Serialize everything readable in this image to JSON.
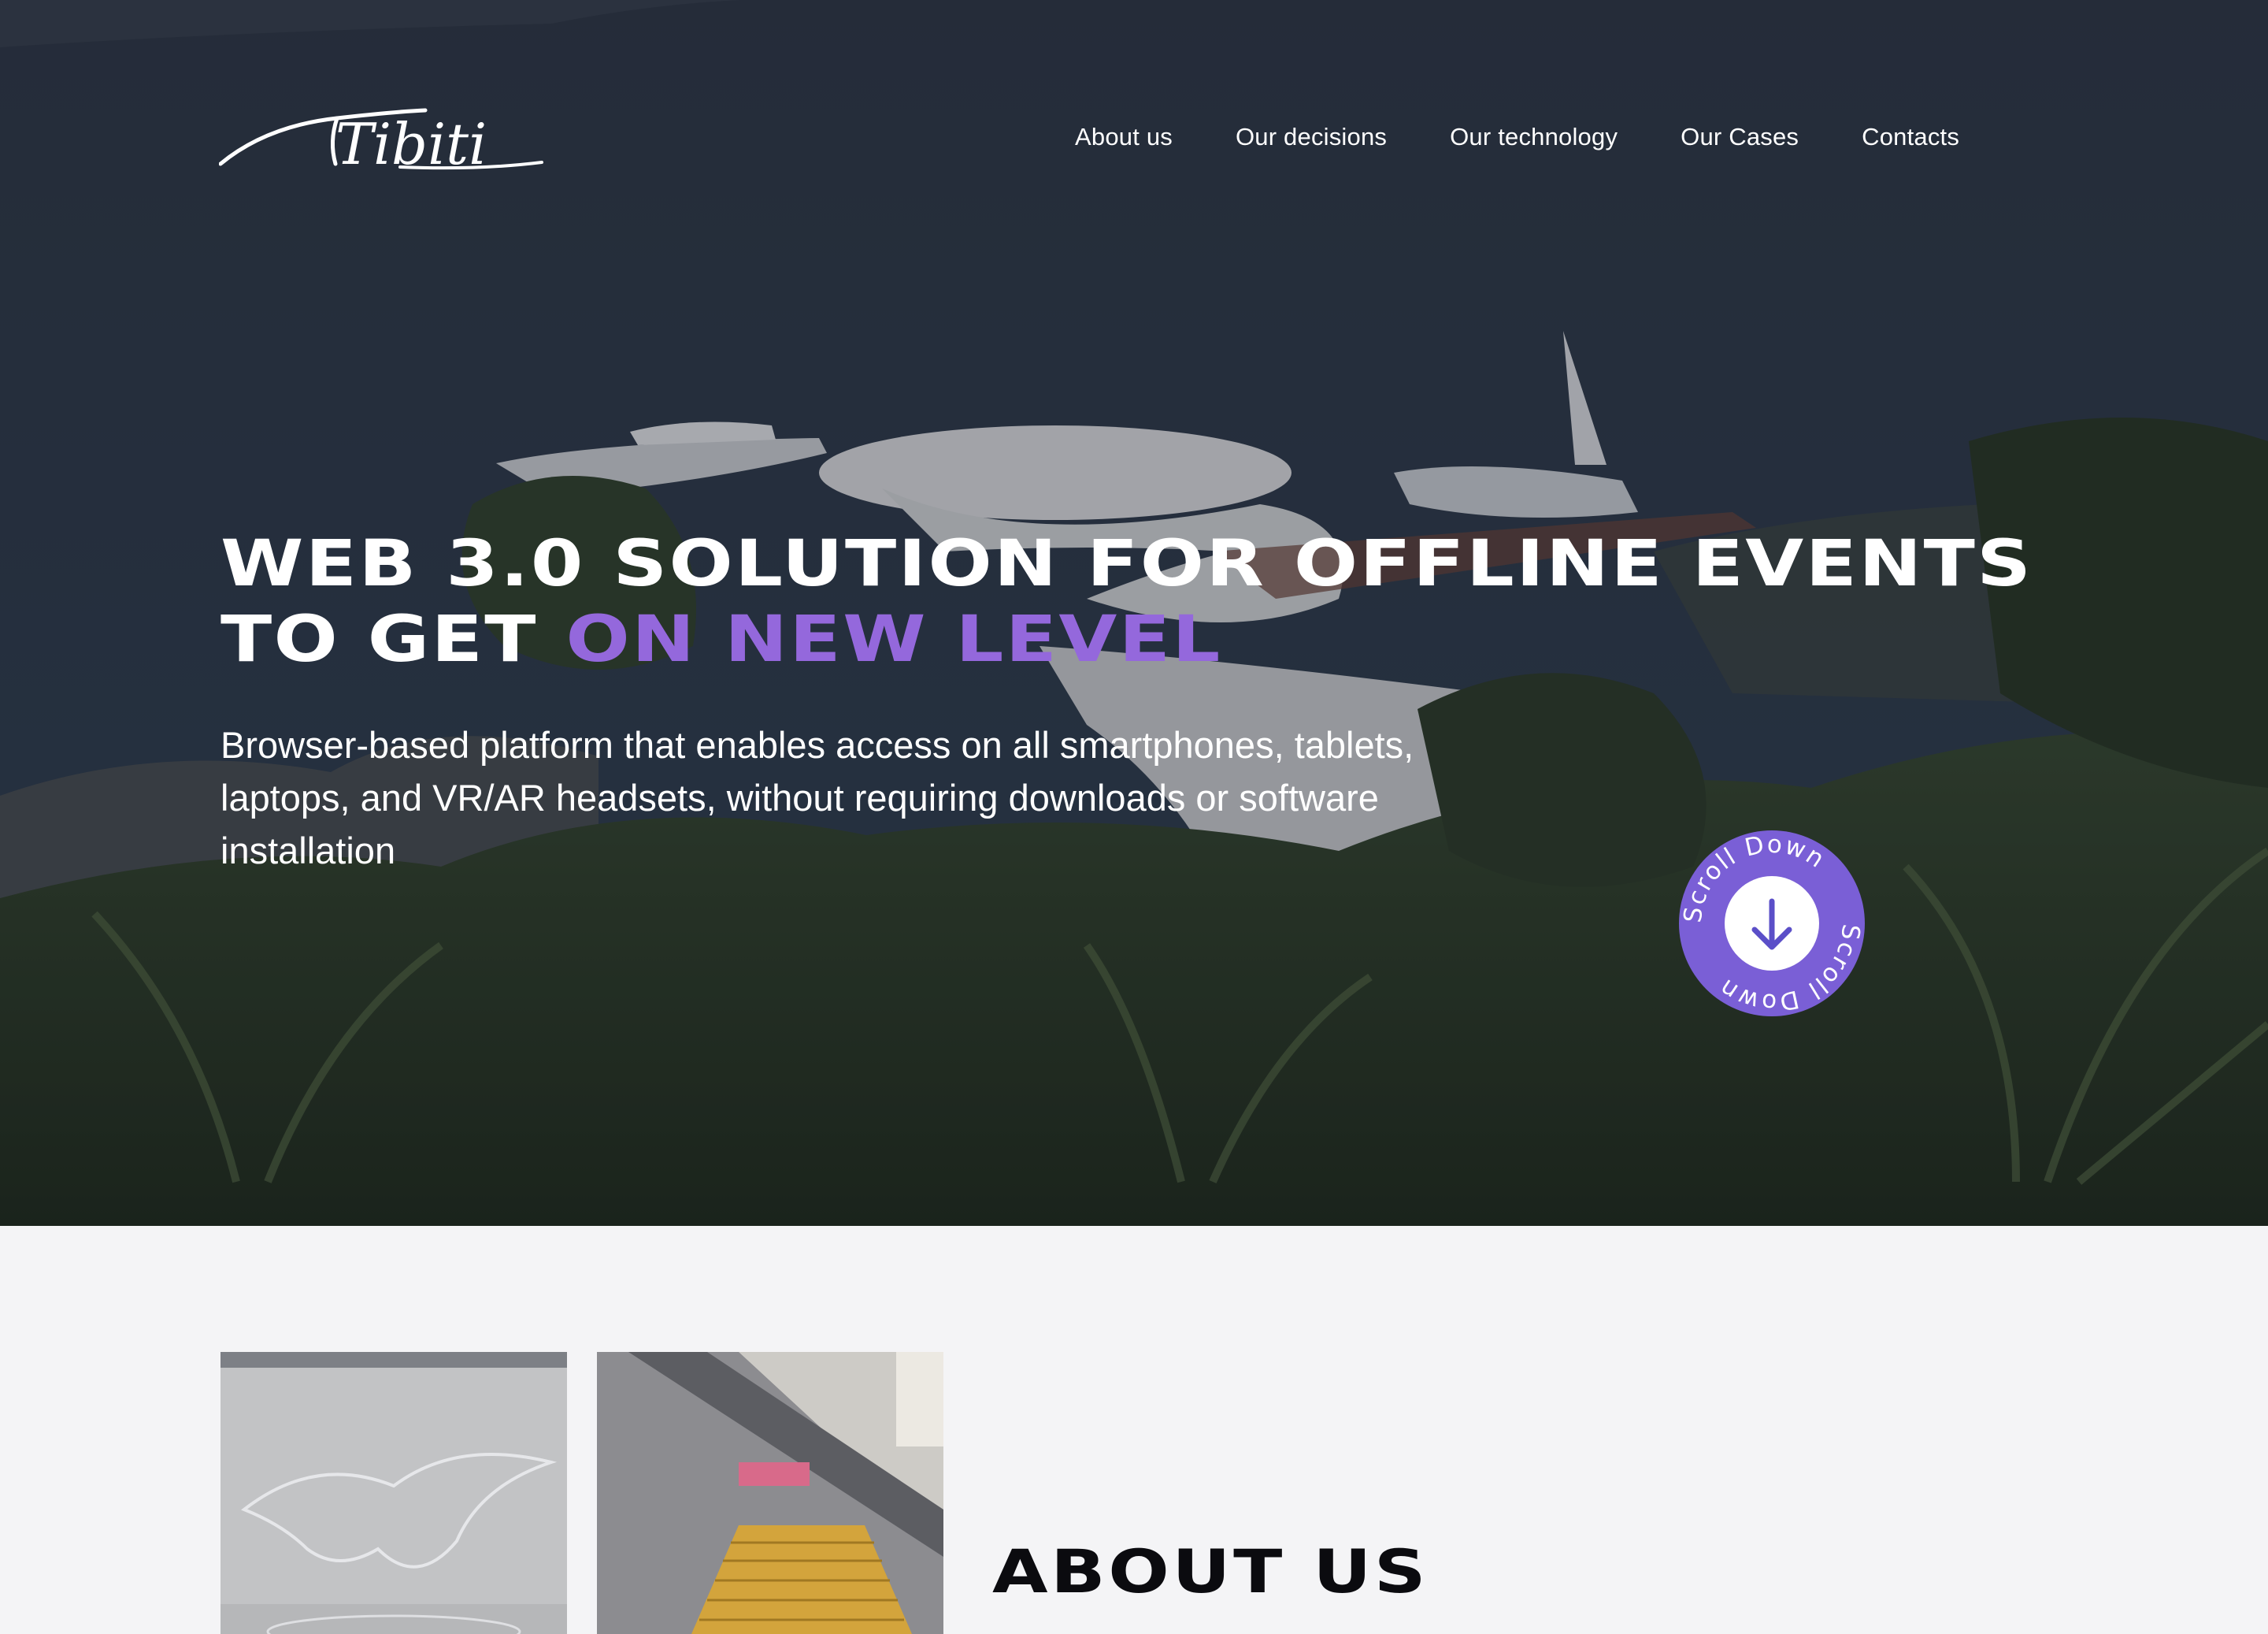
{
  "brand": {
    "logo_text": "Tibiti"
  },
  "nav": {
    "items": [
      {
        "label": "About us"
      },
      {
        "label": "Our decisions"
      },
      {
        "label": "Our technology"
      },
      {
        "label": "Our Cases"
      },
      {
        "label": "Contacts"
      }
    ]
  },
  "hero": {
    "headline_line1": "WEB 3.0 SOLUTION FOR OFFLINE EVENTS",
    "headline_line2_prefix": "TO GET ",
    "headline_line2_accent": "ON NEW LEVEL",
    "subtitle": "Browser-based platform that enables access on all smartphones, tablets, laptops, and VR/AR headsets, without requiring downloads or software installation",
    "scroll_label": "Scroll Down",
    "scroll_icon": "arrow-down-icon"
  },
  "about": {
    "title": "ABOUT US"
  },
  "colors": {
    "accent": "#9468dc",
    "badge": "#7a5fd6",
    "page_bg": "#f4f4f6",
    "heading_dark": "#0b0b0f"
  }
}
